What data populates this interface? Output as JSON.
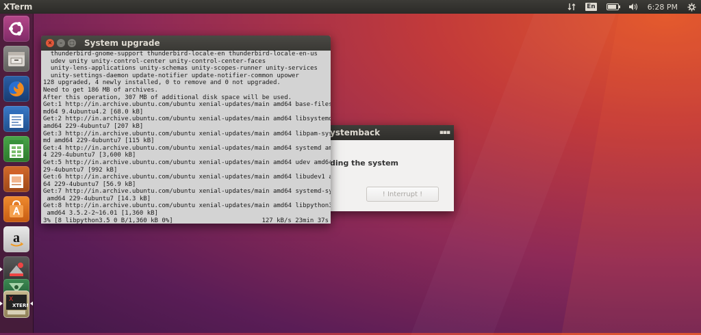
{
  "topbar": {
    "app_title": "XTerm",
    "keyboard_lang": "En",
    "battery_level": 0.85,
    "time": "6:28 PM"
  },
  "launcher": {
    "items": [
      {
        "name": "ubuntu-dash",
        "icon": "ubuntu-logo-icon"
      },
      {
        "name": "files",
        "icon": "file-cabinet-icon"
      },
      {
        "name": "firefox",
        "icon": "firefox-icon"
      },
      {
        "name": "libreoffice-writer",
        "icon": "writer-doc-icon"
      },
      {
        "name": "libreoffice-calc",
        "icon": "calc-sheet-icon"
      },
      {
        "name": "libreoffice-impress",
        "icon": "impress-slide-icon"
      },
      {
        "name": "ubuntu-software",
        "icon": "software-bag-icon"
      },
      {
        "name": "amazon",
        "icon": "amazon-icon"
      },
      {
        "name": "systemback",
        "icon": "systemback-icon"
      },
      {
        "name": "system-settings",
        "icon": "settings-icon"
      },
      {
        "name": "xterm",
        "icon": "xterm-icon",
        "label": "XTERM"
      }
    ]
  },
  "terminal": {
    "title": "System upgrade",
    "lines": [
      "  thunderbird-gnome-support thunderbird-locale-en thunderbird-locale-en-us",
      "  udev unity unity-control-center unity-control-center-faces",
      "  unity-lens-applications unity-schemas unity-scopes-runner unity-services",
      "  unity-settings-daemon update-notifier update-notifier-common upower",
      "128 upgraded, 4 newly installed, 0 to remove and 0 not upgraded.",
      "Need to get 186 MB of archives.",
      "After this operation, 307 MB of additional disk space will be used.",
      "Get:1 http://in.archive.ubuntu.com/ubuntu xenial-updates/main amd64 base-files a",
      "md64 9.4ubuntu4.2 [68.0 kB]",
      "Get:2 http://in.archive.ubuntu.com/ubuntu xenial-updates/main amd64 libsystemd0",
      "amd64 229-4ubuntu7 [207 kB]",
      "Get:3 http://in.archive.ubuntu.com/ubuntu xenial-updates/main amd64 libpam-syste",
      "md amd64 229-4ubuntu7 [115 kB]",
      "Get:4 http://in.archive.ubuntu.com/ubuntu xenial-updates/main amd64 systemd amd6",
      "4 229-4ubuntu7 [3,600 kB]",
      "Get:5 http://in.archive.ubuntu.com/ubuntu xenial-updates/main amd64 udev amd64 2",
      "29-4ubuntu7 [992 kB]",
      "Get:6 http://in.archive.ubuntu.com/ubuntu xenial-updates/main amd64 libudev1 amd",
      "64 229-4ubuntu7 [56.9 kB]",
      "Get:7 http://in.archive.ubuntu.com/ubuntu xenial-updates/main amd64 systemd-sysv",
      " amd64 229-4ubuntu7 [14.3 kB]",
      "Get:8 http://in.archive.ubuntu.com/ubuntu xenial-updates/main amd64 libpython3.5",
      " amd64 3.5.2-2~16.01 [1,360 kB]"
    ],
    "status_left": "3% [8 libpython3.5 0 B/1,360 kB 0%]",
    "status_right": "127 kB/s 23min 37s"
  },
  "systemback": {
    "title": "ystemback",
    "message": "ding the system",
    "interrupt_label": "! Interrupt !"
  }
}
